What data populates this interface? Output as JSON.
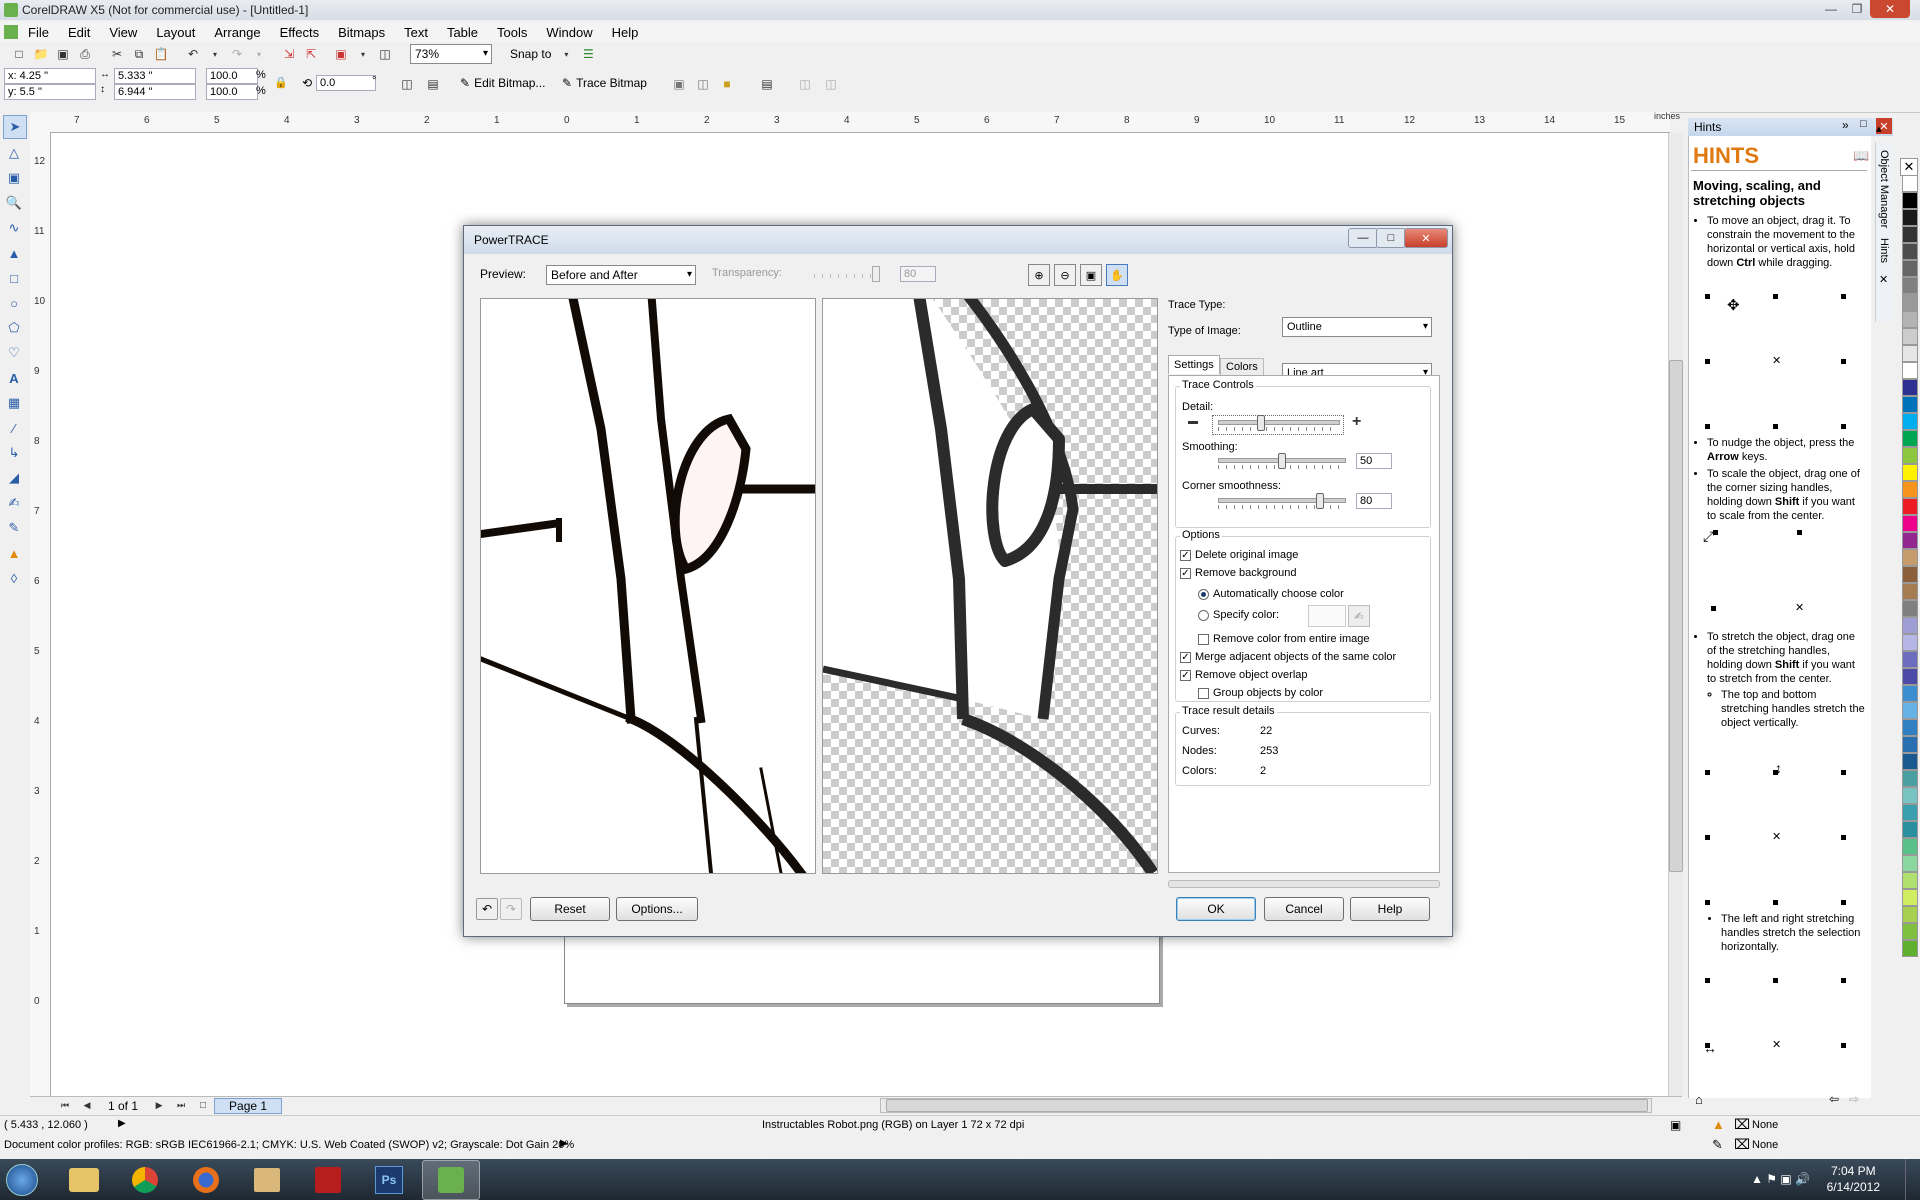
{
  "window": {
    "title": "CorelDRAW X5 (Not for commercial use) - [Untitled-1]"
  },
  "menu": [
    "File",
    "Edit",
    "View",
    "Layout",
    "Arrange",
    "Effects",
    "Bitmaps",
    "Text",
    "Table",
    "Tools",
    "Window",
    "Help"
  ],
  "toolbar": {
    "zoom": "73%",
    "snap_to": "Snap to"
  },
  "propbar": {
    "x": "x: 4.25 \"",
    "y": "y: 5.5 \"",
    "w": "5.333 \"",
    "h": "6.944 \"",
    "scale_x": "100.0",
    "scale_y": "100.0",
    "pct": "%",
    "angle": "0.0",
    "deg": "°",
    "edit_bitmap": "Edit Bitmap...",
    "trace_bitmap": "Trace Bitmap"
  },
  "ruler": {
    "h_labels": [
      "7",
      "6",
      "5",
      "4",
      "3",
      "2",
      "1",
      "0",
      "1",
      "2",
      "3",
      "4",
      "5",
      "6",
      "7",
      "8",
      "9",
      "10",
      "11",
      "12",
      "13",
      "14",
      "15"
    ],
    "v_labels": [
      "12",
      "11",
      "10",
      "9",
      "8",
      "7",
      "6",
      "5",
      "4",
      "3",
      "2",
      "1",
      "0"
    ],
    "unit": "inches"
  },
  "pagenav": {
    "count": "1 of 1",
    "tab": "Page 1"
  },
  "status": {
    "coords": "( 5.433 , 12.060 )",
    "object_info": "Instructables Robot.png (RGB) on Layer 1 72 x 72 dpi",
    "profiles": "Document color profiles: RGB: sRGB IEC61966-2.1; CMYK: U.S. Web Coated (SWOP) v2; Grayscale: Dot Gain 20%",
    "fill": "None",
    "outline": "None"
  },
  "clock": {
    "time": "7:04 PM",
    "date": "6/14/2012"
  },
  "hints": {
    "panel_title": "Hints",
    "heading": "HINTS",
    "topic": "Moving, scaling, and stretching objects",
    "p1_a": "To move an object, drag it. To constrain the movement to the horizontal or vertical axis, hold down ",
    "p1_key": "Ctrl",
    "p1_b": " while dragging.",
    "p2_a": "To nudge the object, press the ",
    "p2_key": "Arrow",
    "p2_b": " keys.",
    "p3_a": "To scale the object, drag one of the corner sizing handles, holding down ",
    "p3_key": "Shift",
    "p3_b": " if you want to scale from the center.",
    "p4_a": "To stretch the object, drag one of the stretching handles, holding down ",
    "p4_key": "Shift",
    "p4_b": " if you want to stretch from the center.",
    "p4_sub": "The top and bottom stretching handles stretch the object vertically.",
    "p5_sub": "The left and right stretching handles stretch the selection horizontally.",
    "tab_object_manager": "Object Manager",
    "tab_hints": "Hints"
  },
  "dialog": {
    "title": "PowerTRACE",
    "preview_label": "Preview:",
    "preview_value": "Before and After",
    "transparency_label": "Transparency:",
    "transparency_value": "80",
    "trace_type_label": "Trace Type:",
    "trace_type_value": "Outline",
    "image_type_label": "Type of Image:",
    "image_type_value": "Line art",
    "tab_settings": "Settings",
    "tab_colors": "Colors",
    "trace_controls": "Trace Controls",
    "detail_label": "Detail:",
    "detail_level": 0.35,
    "smoothing_label": "Smoothing:",
    "smoothing_value": "50",
    "corner_label": "Corner smoothness:",
    "corner_value": "80",
    "options_label": "Options",
    "opt_delete": "Delete original image",
    "opt_remove_bg": "Remove background",
    "opt_auto_color": "Automatically choose color",
    "opt_specify_color": "Specify color:",
    "opt_remove_entire": "Remove color from entire image",
    "opt_merge": "Merge adjacent objects of the same color",
    "opt_overlap": "Remove object overlap",
    "opt_group": "Group objects by color",
    "result_label": "Trace result details",
    "curves_label": "Curves:",
    "curves_value": "22",
    "nodes_label": "Nodes:",
    "nodes_value": "253",
    "colors_label": "Colors:",
    "colors_value": "2",
    "reset": "Reset",
    "options": "Options...",
    "ok": "OK",
    "cancel": "Cancel",
    "help": "Help"
  },
  "palette_colors": [
    "#ffffff",
    "#000000",
    "#1a1a1a",
    "#333333",
    "#4d4d4d",
    "#666666",
    "#808080",
    "#999999",
    "#b3b3b3",
    "#cccccc",
    "#e6e6e6",
    "#ffffff",
    "#2e3192",
    "#0072bc",
    "#00aeef",
    "#00a651",
    "#8dc63f",
    "#fff200",
    "#f7941d",
    "#ed1c24",
    "#ec008c",
    "#92278f",
    "#c69c6d",
    "#8b5e3c",
    "#a67c52",
    "#7f7f7f",
    "#9e9ed4",
    "#b5b5e6",
    "#6d6dc0",
    "#4c4ca8",
    "#3b8fd0",
    "#66b2e6",
    "#2f7fc1",
    "#2a6fb0",
    "#1a5a90",
    "#4aa0a0",
    "#7ac3c3",
    "#3aa0b0",
    "#2a90a0",
    "#5ac08a",
    "#8ad8a0",
    "#b0e070",
    "#d0ec60",
    "#a8d050",
    "#80c040",
    "#60b030"
  ]
}
